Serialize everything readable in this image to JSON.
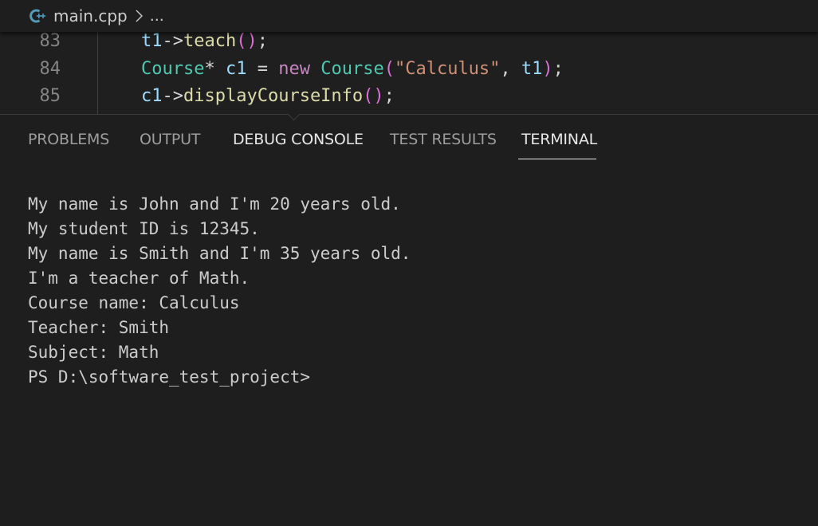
{
  "breadcrumb": {
    "file_icon": "cpp-file-icon",
    "file_name": "main.cpp",
    "separator_icon": "chevron-right-icon",
    "ellipsis": "..."
  },
  "editor": {
    "lines": [
      {
        "number": "83",
        "tokens": [
          {
            "text": "t1",
            "kind": "var"
          },
          {
            "text": "->",
            "kind": "op"
          },
          {
            "text": "teach",
            "kind": "fn"
          },
          {
            "text": "()",
            "kind": "paren"
          },
          {
            "text": ";",
            "kind": "op"
          }
        ]
      },
      {
        "number": "84",
        "tokens": [
          {
            "text": "Course",
            "kind": "type"
          },
          {
            "text": "* ",
            "kind": "op"
          },
          {
            "text": "c1",
            "kind": "var"
          },
          {
            "text": " = ",
            "kind": "op"
          },
          {
            "text": "new",
            "kind": "kw"
          },
          {
            "text": " ",
            "kind": "op"
          },
          {
            "text": "Course",
            "kind": "type"
          },
          {
            "text": "(",
            "kind": "paren"
          },
          {
            "text": "\"Calculus\"",
            "kind": "str"
          },
          {
            "text": ", ",
            "kind": "op"
          },
          {
            "text": "t1",
            "kind": "var"
          },
          {
            "text": ")",
            "kind": "paren"
          },
          {
            "text": ";",
            "kind": "op"
          }
        ]
      },
      {
        "number": "85",
        "tokens": [
          {
            "text": "c1",
            "kind": "var"
          },
          {
            "text": "->",
            "kind": "op"
          },
          {
            "text": "displayCourseInfo",
            "kind": "fn"
          },
          {
            "text": "()",
            "kind": "paren"
          },
          {
            "text": ";",
            "kind": "op"
          }
        ]
      }
    ]
  },
  "panel": {
    "tabs": {
      "problems": "PROBLEMS",
      "output": "OUTPUT",
      "debug_console": "DEBUG CONSOLE",
      "test_results": "TEST RESULTS",
      "terminal": "TERMINAL"
    },
    "active_tab": "TERMINAL",
    "terminal_lines": [
      "My name is John and I'm 20 years old.",
      "My student ID is 12345.",
      "My name is Smith and I'm 35 years old.",
      "I'm a teacher of Math.",
      "Course name: Calculus",
      "Teacher: Smith",
      "Subject: Math",
      "PS D:\\software_test_project>"
    ]
  },
  "colors": {
    "background": "#1e1e1e",
    "line_number": "#858585",
    "variable": "#9cdcfe",
    "function": "#dcdcaa",
    "type": "#4ec9b0",
    "keyword": "#c586c0",
    "string": "#ce9178",
    "bracket": "#da70d6",
    "cpp_icon": "#519aba"
  }
}
